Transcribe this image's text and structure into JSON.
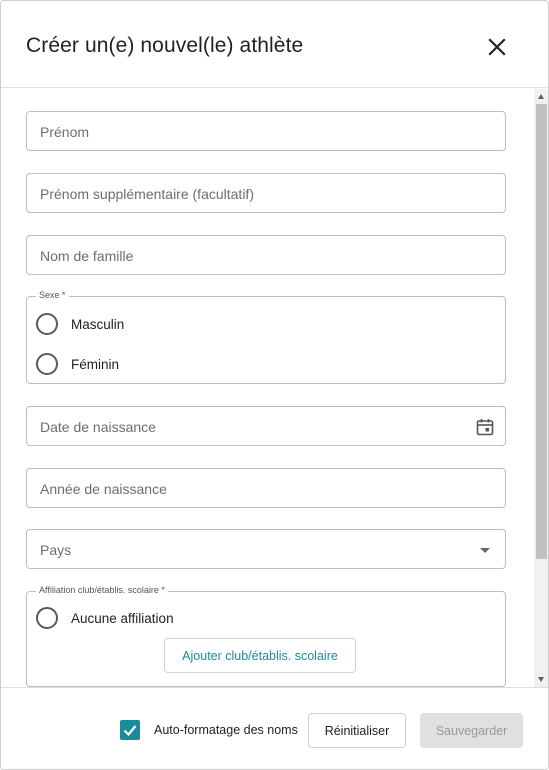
{
  "dialog": {
    "title": "Créer un(e) nouvel(le) athlète",
    "close_icon": "close-icon"
  },
  "form": {
    "first_name_placeholder": "Prénom",
    "middle_name_placeholder": "Prénom supplémentaire (facultatif)",
    "last_name_placeholder": "Nom de famille",
    "sex": {
      "legend": "Sexe *",
      "options": [
        "Masculin",
        "Féminin"
      ],
      "selected": null
    },
    "birth_date_placeholder": "Date de naissance",
    "birth_date_icon": "calendar-icon",
    "birth_year_placeholder": "Année de naissance",
    "country_placeholder": "Pays",
    "country_icon": "dropdown-arrow-icon",
    "affiliation": {
      "legend": "Affiliation club/établis. scolaire *",
      "options": [
        "Aucune affiliation"
      ],
      "add_button_label": "Ajouter club/établis. scolaire"
    }
  },
  "footer": {
    "auto_format_label": "Auto-formatage des noms",
    "auto_format_checked": true,
    "reset_label": "Réinitialiser",
    "save_label": "Sauvegarder"
  },
  "colors": {
    "accent": "#1a8c99",
    "disabled_bg": "#e0e0e0",
    "disabled_text": "#9a9a9a"
  }
}
